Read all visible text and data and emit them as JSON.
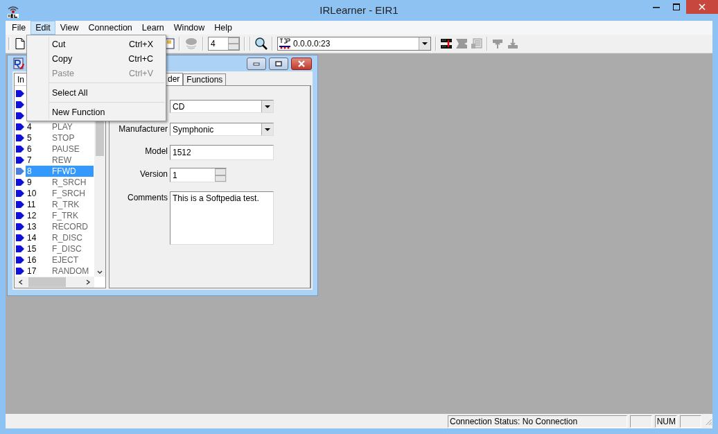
{
  "window": {
    "title": "IRLearner - EIR1"
  },
  "menu": [
    {
      "label": "File",
      "selected": false
    },
    {
      "label": "Edit",
      "selected": true
    },
    {
      "label": "View",
      "selected": false
    },
    {
      "label": "Connection",
      "selected": false
    },
    {
      "label": "Learn",
      "selected": false
    },
    {
      "label": "Window",
      "selected": false
    },
    {
      "label": "Help",
      "selected": false
    }
  ],
  "edit_menu": [
    {
      "kind": "item",
      "label": "Cut",
      "shortcut": "Ctrl+X",
      "disabled": false
    },
    {
      "kind": "item",
      "label": "Copy",
      "shortcut": "Ctrl+C",
      "disabled": false
    },
    {
      "kind": "item",
      "label": "Paste",
      "shortcut": "Ctrl+V",
      "disabled": true
    },
    {
      "kind": "separator"
    },
    {
      "kind": "item",
      "label": "Select All",
      "disabled": false
    },
    {
      "kind": "separator"
    },
    {
      "kind": "item",
      "label": "New Function",
      "disabled": false
    }
  ],
  "toolbar": {
    "channel": "4",
    "address": "0.0.0.0:23"
  },
  "child_window": {
    "list_header": "In",
    "rows": [
      {
        "selected": false
      },
      {
        "selected": false
      },
      {
        "selected": false
      },
      {
        "index": "4",
        "name": "PLAY",
        "selected": false
      },
      {
        "index": "5",
        "name": "STOP",
        "selected": false
      },
      {
        "index": "6",
        "name": "PAUSE",
        "selected": false
      },
      {
        "index": "7",
        "name": "REW",
        "selected": false
      },
      {
        "index": "8",
        "name": "FFWD",
        "selected": true
      },
      {
        "index": "9",
        "name": "R_SRCH",
        "selected": false
      },
      {
        "index": "10",
        "name": "F_SRCH",
        "selected": false
      },
      {
        "index": "11",
        "name": "R_TRK",
        "selected": false
      },
      {
        "index": "12",
        "name": "F_TRK",
        "selected": false
      },
      {
        "index": "13",
        "name": "RECORD",
        "selected": false
      },
      {
        "index": "14",
        "name": "R_DISC",
        "selected": false
      },
      {
        "index": "15",
        "name": "F_DISC",
        "selected": false
      },
      {
        "index": "16",
        "name": "EJECT",
        "selected": false
      },
      {
        "index": "17",
        "name": "RANDOM",
        "selected": false
      }
    ],
    "tabs": [
      {
        "label": "der",
        "selected": true
      },
      {
        "label": "Functions",
        "selected": false
      }
    ],
    "fields": [
      {
        "kind": "dropdown",
        "value": "CD"
      },
      {
        "kind": "dropdown",
        "label": "Manufacturer",
        "value": "Symphonic"
      },
      {
        "kind": "text",
        "label": "Model",
        "value": "1512"
      },
      {
        "kind": "spin",
        "label": "Version",
        "value": "1"
      },
      {
        "kind": "memo",
        "label": "Comments",
        "value": "This is a Softpedia test."
      }
    ]
  },
  "status_bar": {
    "connection": "Connection Status: No Connection",
    "num": "NUM"
  }
}
